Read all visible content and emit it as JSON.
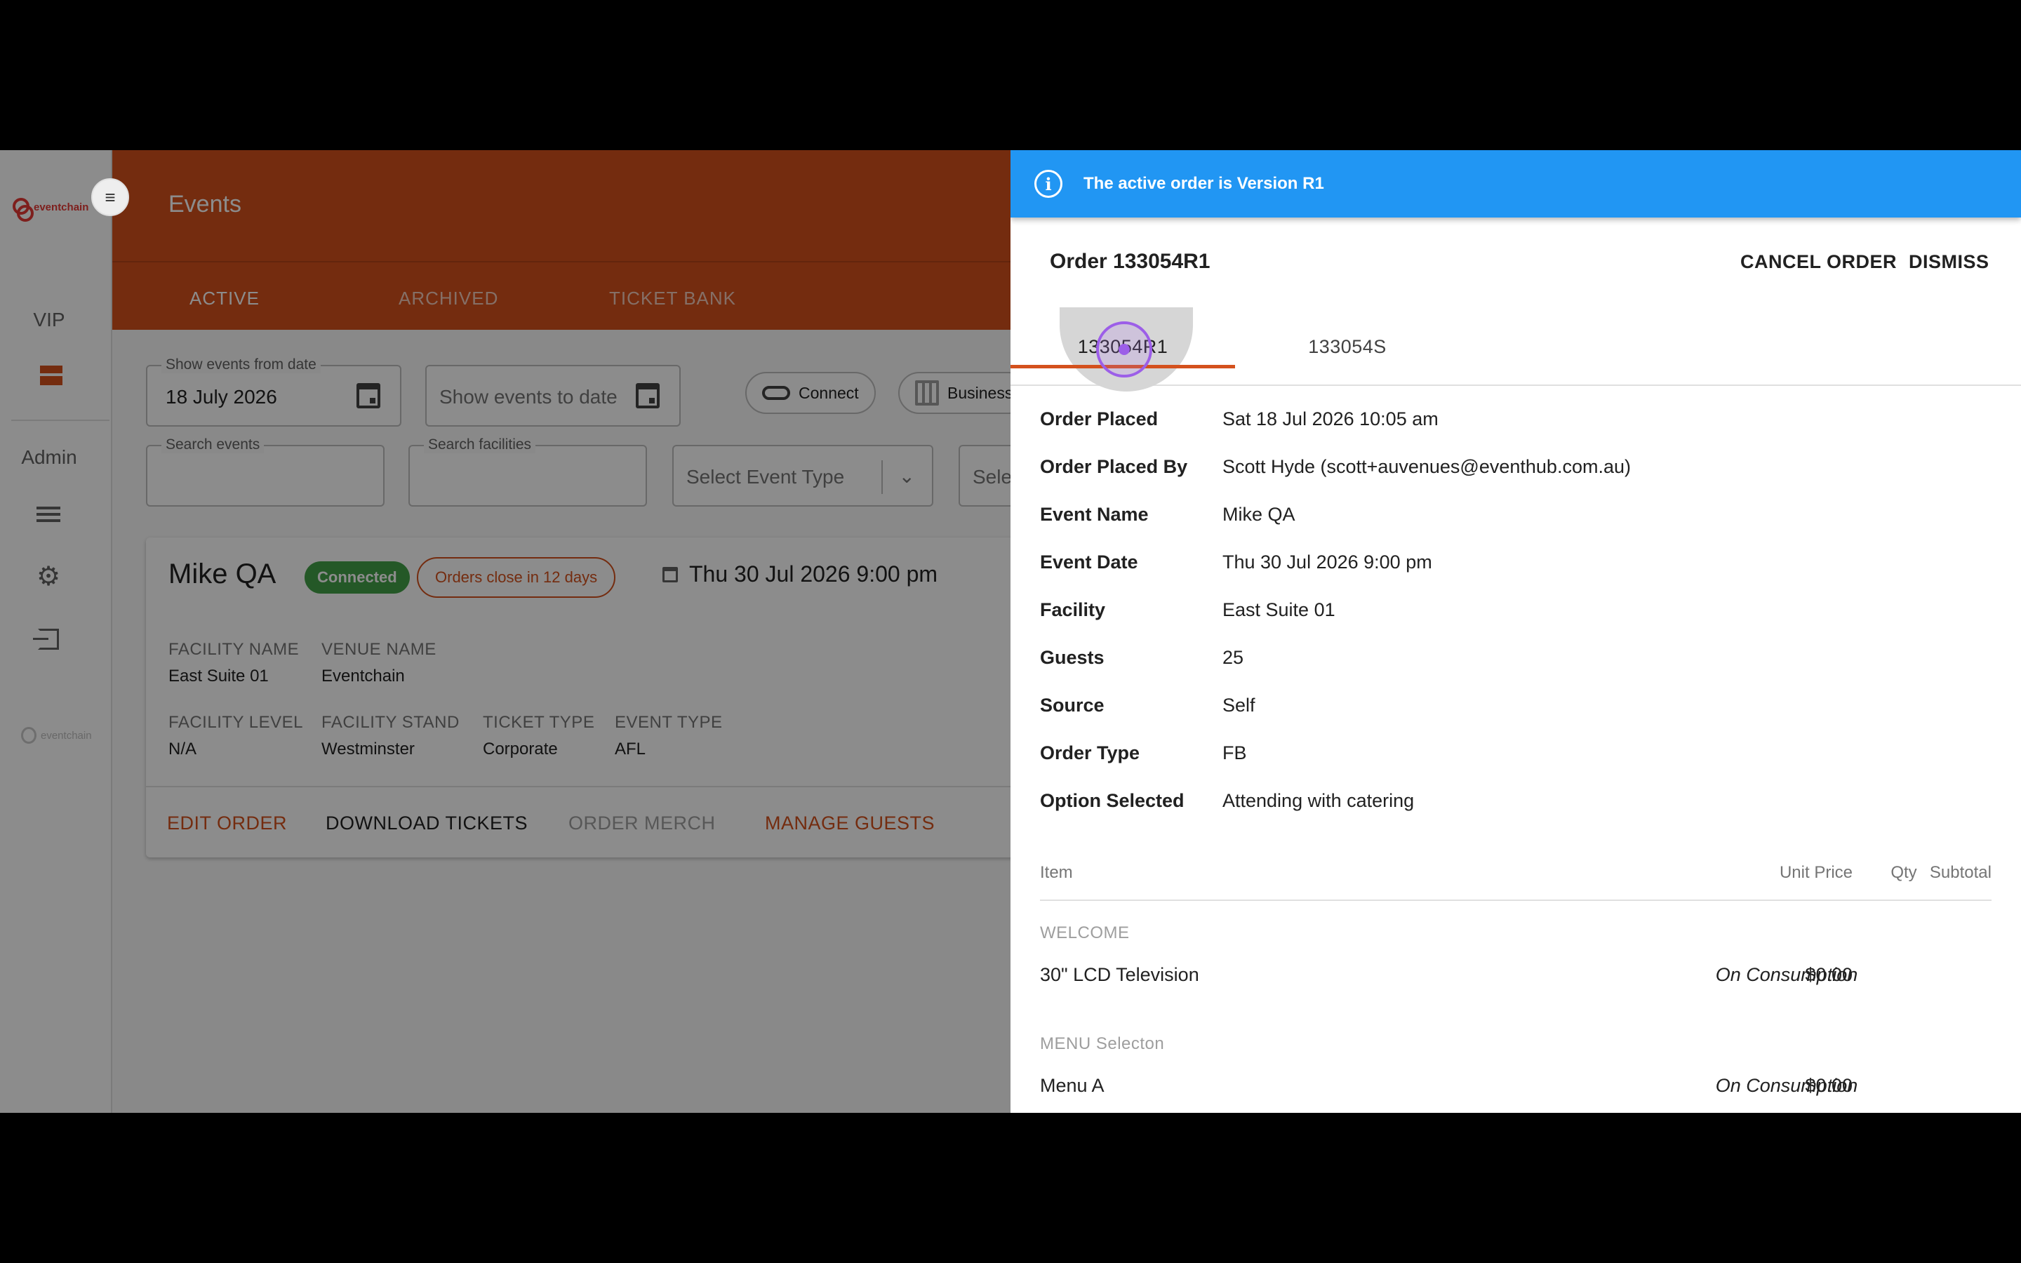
{
  "sidebar": {
    "logo_text": "eventchain",
    "vip_label": "VIP",
    "admin_label": "Admin",
    "footer_logo_text": "eventchain"
  },
  "header": {
    "title": "Events",
    "tabs": [
      {
        "label": "ACTIVE",
        "active": true
      },
      {
        "label": "ARCHIVED",
        "active": false
      },
      {
        "label": "TICKET BANK",
        "active": false
      }
    ]
  },
  "filters": {
    "from_date_label": "Show events from date",
    "from_date_value": "18 July 2026",
    "to_date_placeholder": "Show events to date",
    "connect_label": "Connect",
    "business_label": "Business",
    "search_events_label": "Search events",
    "search_facilities_label": "Search facilities",
    "event_type_placeholder": "Select Event Type",
    "fourth_select_placeholder": "Sele"
  },
  "event_card": {
    "name": "Mike QA",
    "status_badge": "Connected",
    "close_badge": "Orders close in 12 days",
    "date": "Thu 30 Jul 2026 9:00 pm",
    "meta": [
      {
        "label": "FACILITY NAME",
        "value": "East Suite 01"
      },
      {
        "label": "VENUE NAME",
        "value": "Eventchain"
      },
      {
        "label": "FACILITY LEVEL",
        "value": "N/A"
      },
      {
        "label": "FACILITY STAND",
        "value": "Westminster"
      },
      {
        "label": "TICKET TYPE",
        "value": "Corporate"
      },
      {
        "label": "EVENT TYPE",
        "value": "AFL"
      }
    ],
    "actions": {
      "edit_order": "EDIT ORDER",
      "download_tickets": "DOWNLOAD TICKETS",
      "order_merch": "ORDER MERCH",
      "manage_guests": "MANAGE GUESTS"
    }
  },
  "drawer": {
    "alert_text": "The active order is Version R1",
    "order_title": "Order 133054R1",
    "cancel_order_label": "CANCEL ORDER",
    "dismiss_label": "DISMISS",
    "version_tabs": [
      {
        "label": "133054R1",
        "active": true
      },
      {
        "label": "133054S",
        "active": false
      }
    ],
    "details": [
      {
        "label": "Order Placed",
        "value": "Sat 18 Jul 2026 10:05 am"
      },
      {
        "label": "Order Placed By",
        "value": "Scott Hyde (scott+auvenues@eventhub.com.au)"
      },
      {
        "label": "Event Name",
        "value": "Mike QA"
      },
      {
        "label": "Event Date",
        "value": "Thu 30 Jul 2026 9:00 pm"
      },
      {
        "label": "Facility",
        "value": "East Suite 01"
      },
      {
        "label": "Guests",
        "value": "25"
      },
      {
        "label": "Source",
        "value": "Self"
      },
      {
        "label": "Order Type",
        "value": "FB"
      },
      {
        "label": "Option Selected",
        "value": "Attending with catering"
      }
    ],
    "table": {
      "headers": {
        "item": "Item",
        "unit_price": "Unit Price",
        "qty": "Qty",
        "subtotal": "Subtotal"
      },
      "sections": [
        {
          "name": "WELCOME",
          "items": [
            {
              "name": "30\" LCD Television",
              "unit_price": "$0.00",
              "qty": "On Consumption"
            }
          ]
        },
        {
          "name": "MENU Selecton",
          "items": [
            {
              "name": "Menu A",
              "unit_price": "$0.00",
              "qty": "On Consumption"
            }
          ]
        }
      ]
    }
  },
  "colors": {
    "brand": "#d4511d",
    "alert": "#2196f3",
    "connected": "#43a047"
  },
  "icons": {
    "menu": "menu-icon",
    "calendar": "calendar-icon",
    "link": "link-icon",
    "settings": "gear-icon",
    "logout": "logout-icon",
    "info": "info-icon"
  }
}
